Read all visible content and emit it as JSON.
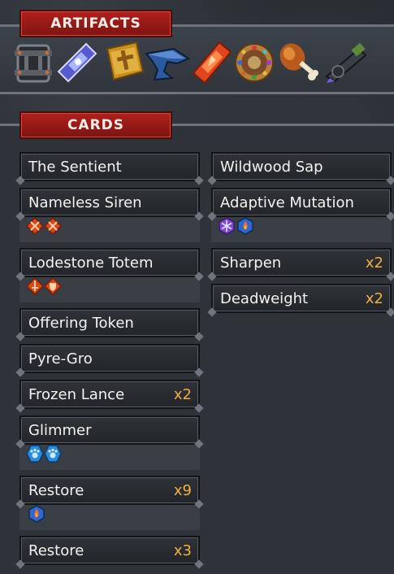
{
  "artifacts": {
    "header": "ARTIFACTS",
    "items": [
      {
        "icon": "iron-cage-icon"
      },
      {
        "icon": "crystal-gem-icon"
      },
      {
        "icon": "golden-cross-tablet-icon"
      },
      {
        "icon": "blue-anvil-icon"
      },
      {
        "icon": "red-gem-icon"
      },
      {
        "icon": "ornate-shield-icon"
      },
      {
        "icon": "drumstick-icon"
      },
      {
        "icon": "cannon-icon"
      }
    ]
  },
  "cards": {
    "header": "CARDS",
    "left": [
      {
        "name": "The Sentient",
        "count": ""
      },
      {
        "name": "Nameless Siren",
        "count": "",
        "badges": [
          "red-crossed-swords-icon",
          "red-crossed-swords-icon"
        ]
      },
      {
        "name": "Lodestone Totem",
        "count": "",
        "badges": [
          "red-sword-icon",
          "red-shield-icon"
        ]
      },
      {
        "name": "Offering Token",
        "count": ""
      },
      {
        "name": "Pyre-Gro",
        "count": ""
      },
      {
        "name": "Frozen Lance",
        "count": "x2"
      },
      {
        "name": "Glimmer",
        "count": "",
        "badges": [
          "blue-paw-icon",
          "blue-paw-icon"
        ]
      },
      {
        "name": "Restore",
        "count": "x9",
        "badges": [
          "blue-flame-icon"
        ]
      },
      {
        "name": "Restore",
        "count": "x3"
      }
    ],
    "right": [
      {
        "name": "Wildwood Sap",
        "count": ""
      },
      {
        "name": "Adaptive Mutation",
        "count": "",
        "badges": [
          "purple-snowflake-icon",
          "blue-flame-icon"
        ]
      },
      {
        "name": "Sharpen",
        "count": "x2"
      },
      {
        "name": "Deadweight",
        "count": "x2"
      }
    ]
  },
  "colors": {
    "header_red": "#a81d19",
    "count_gold": "#f0b040",
    "badge_red": "#d4481c",
    "badge_blue": "#2a8ae0",
    "badge_purple": "#7a4ad0"
  }
}
